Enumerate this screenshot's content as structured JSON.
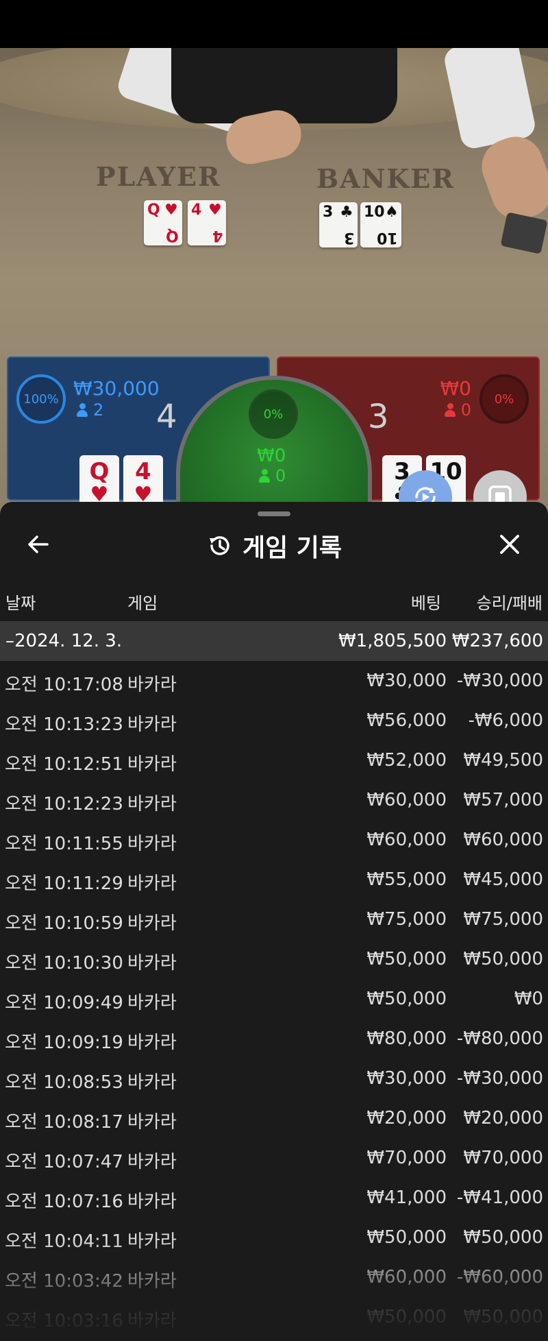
{
  "table": {
    "player_label": "PLAYER",
    "banker_label": "BANKER",
    "player_cards": [
      {
        "rank": "Q",
        "suit": "♥"
      },
      {
        "rank": "4",
        "suit": "♥"
      }
    ],
    "banker_cards": [
      {
        "rank": "3",
        "suit": "♣"
      },
      {
        "rank": "10",
        "suit": "♠"
      }
    ]
  },
  "result_panel": {
    "player": {
      "percent": "100%",
      "amount": "₩30,000",
      "count": "2",
      "score": "4",
      "cards": [
        {
          "rank": "Q",
          "suit": "♥"
        },
        {
          "rank": "4",
          "suit": "♥"
        }
      ]
    },
    "tie": {
      "percent": "0%",
      "amount": "₩0",
      "count": "0"
    },
    "banker": {
      "percent": "0%",
      "amount": "₩0",
      "count": "0",
      "score": "3",
      "cards": [
        {
          "rank": "3",
          "suit": "♣"
        },
        {
          "rank": "10",
          "suit": "♠"
        }
      ]
    }
  },
  "colors": {
    "player": "#2a87e0",
    "banker": "#e63a3a",
    "tie": "#2fd436",
    "sheet_bg": "#1b1b1b"
  },
  "history": {
    "title": "게임 기록",
    "icons": {
      "back": "arrow-left-icon",
      "title": "history-icon",
      "close": "close-icon"
    },
    "columns": {
      "date": "날짜",
      "game": "게임",
      "bet": "베팅",
      "win_loss": "승리/패배"
    },
    "summary": {
      "date": "–2024. 12. 3.",
      "bet": "₩1,805,500",
      "win_loss": "₩237,600"
    },
    "rows": [
      {
        "time": "오전 10:17:08",
        "game": "바카라",
        "bet": "₩30,000",
        "win_loss": "-₩30,000"
      },
      {
        "time": "오전 10:13:23",
        "game": "바카라",
        "bet": "₩56,000",
        "win_loss": "-₩6,000"
      },
      {
        "time": "오전 10:12:51",
        "game": "바카라",
        "bet": "₩52,000",
        "win_loss": "₩49,500"
      },
      {
        "time": "오전 10:12:23",
        "game": "바카라",
        "bet": "₩60,000",
        "win_loss": "₩57,000"
      },
      {
        "time": "오전 10:11:55",
        "game": "바카라",
        "bet": "₩60,000",
        "win_loss": "₩60,000"
      },
      {
        "time": "오전 10:11:29",
        "game": "바카라",
        "bet": "₩55,000",
        "win_loss": "₩45,000"
      },
      {
        "time": "오전 10:10:59",
        "game": "바카라",
        "bet": "₩75,000",
        "win_loss": "₩75,000"
      },
      {
        "time": "오전 10:10:30",
        "game": "바카라",
        "bet": "₩50,000",
        "win_loss": "₩50,000"
      },
      {
        "time": "오전 10:09:49",
        "game": "바카라",
        "bet": "₩50,000",
        "win_loss": "₩0"
      },
      {
        "time": "오전 10:09:19",
        "game": "바카라",
        "bet": "₩80,000",
        "win_loss": "-₩80,000"
      },
      {
        "time": "오전 10:08:53",
        "game": "바카라",
        "bet": "₩30,000",
        "win_loss": "-₩30,000"
      },
      {
        "time": "오전 10:08:17",
        "game": "바카라",
        "bet": "₩20,000",
        "win_loss": "₩20,000"
      },
      {
        "time": "오전 10:07:47",
        "game": "바카라",
        "bet": "₩70,000",
        "win_loss": "₩70,000"
      },
      {
        "time": "오전 10:07:16",
        "game": "바카라",
        "bet": "₩41,000",
        "win_loss": "-₩41,000"
      },
      {
        "time": "오전 10:04:11",
        "game": "바카라",
        "bet": "₩50,000",
        "win_loss": "₩50,000"
      },
      {
        "time": "오전 10:03:42",
        "game": "바카라",
        "bet": "₩60,000",
        "win_loss": "-₩60,000"
      },
      {
        "time": "오전 10:03:16",
        "game": "바카라",
        "bet": "₩50,000",
        "win_loss": "₩50,000"
      }
    ]
  },
  "controls": {
    "rotate_icon": "rotate-video-icon",
    "stop_icon": "stop-icon"
  }
}
